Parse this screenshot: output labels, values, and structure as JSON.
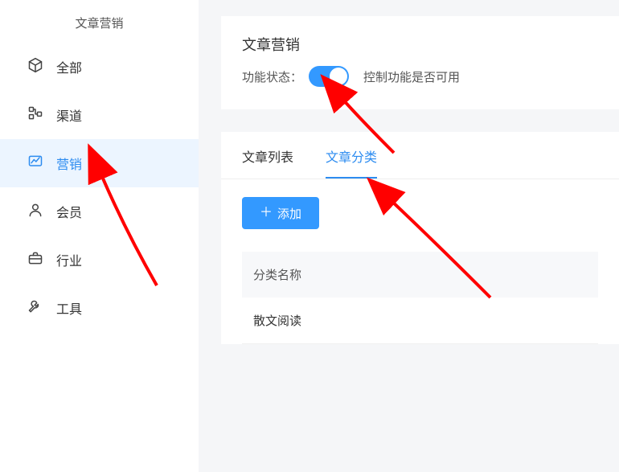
{
  "sidebar": {
    "title": "文章营销",
    "items": [
      {
        "label": "全部"
      },
      {
        "label": "渠道"
      },
      {
        "label": "营销"
      },
      {
        "label": "会员"
      },
      {
        "label": "行业"
      },
      {
        "label": "工具"
      }
    ],
    "activeIndex": 2
  },
  "topPanel": {
    "title": "文章营销",
    "statusLabel": "功能状态：",
    "statusHint": "控制功能是否可用",
    "switchOn": true
  },
  "tabs": {
    "items": [
      {
        "label": "文章列表"
      },
      {
        "label": "文章分类"
      }
    ],
    "activeIndex": 1
  },
  "addButton": {
    "label": "添加"
  },
  "table": {
    "header": "分类名称",
    "rows": [
      {
        "name": "散文阅读"
      }
    ]
  },
  "colors": {
    "accent": "#2d8cf0",
    "arrow": "#ff0000"
  }
}
